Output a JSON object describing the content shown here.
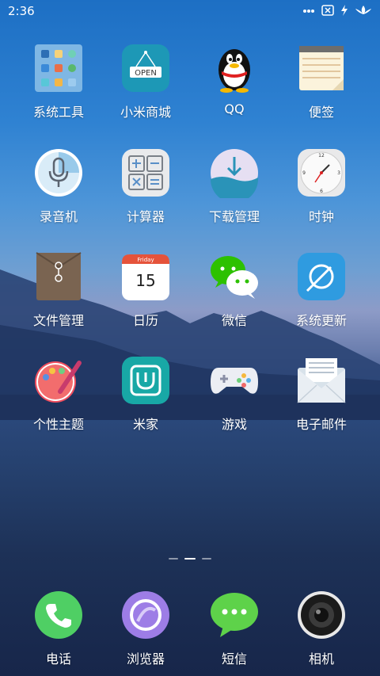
{
  "status": {
    "time": "2:36"
  },
  "apps": [
    {
      "label": "系统工具",
      "icon": "system-tools-folder-icon"
    },
    {
      "label": "小米商城",
      "icon": "mi-store-icon",
      "sign_text": "OPEN"
    },
    {
      "label": "QQ",
      "icon": "qq-penguin-icon"
    },
    {
      "label": "便签",
      "icon": "notes-icon"
    },
    {
      "label": "录音机",
      "icon": "recorder-microphone-icon"
    },
    {
      "label": "计算器",
      "icon": "calculator-icon"
    },
    {
      "label": "下载管理",
      "icon": "download-manager-icon"
    },
    {
      "label": "时钟",
      "icon": "clock-icon"
    },
    {
      "label": "文件管理",
      "icon": "file-manager-envelope-icon"
    },
    {
      "label": "日历",
      "icon": "calendar-icon",
      "day_name": "Friday",
      "day_number": "15"
    },
    {
      "label": "微信",
      "icon": "wechat-icon"
    },
    {
      "label": "系统更新",
      "icon": "system-update-icon"
    },
    {
      "label": "个性主题",
      "icon": "themes-palette-icon"
    },
    {
      "label": "米家",
      "icon": "mi-home-icon"
    },
    {
      "label": "游戏",
      "icon": "games-controller-icon"
    },
    {
      "label": "电子邮件",
      "icon": "email-envelope-icon"
    }
  ],
  "dock": [
    {
      "label": "电话",
      "icon": "phone-icon"
    },
    {
      "label": "浏览器",
      "icon": "browser-icon"
    },
    {
      "label": "短信",
      "icon": "messages-icon"
    },
    {
      "label": "相机",
      "icon": "camera-icon"
    }
  ],
  "pager": {
    "count": 3,
    "active": 1
  }
}
